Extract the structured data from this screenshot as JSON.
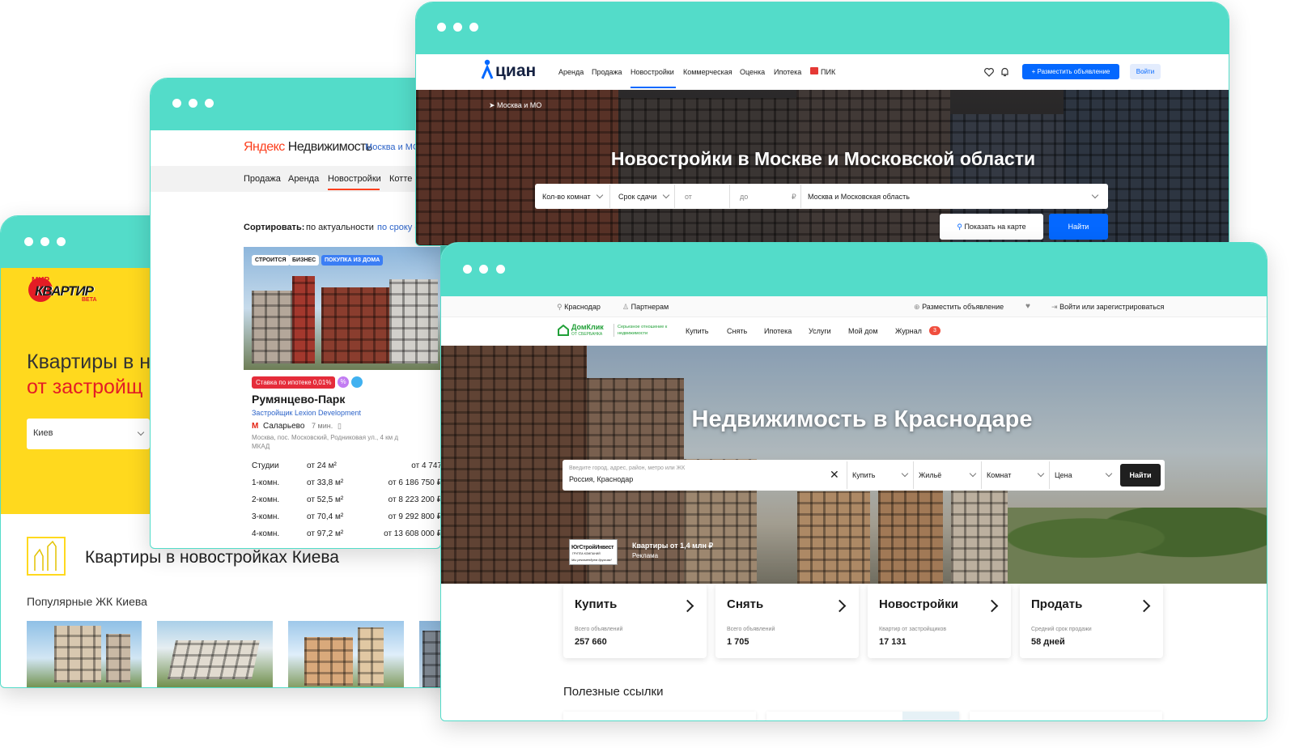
{
  "mirkvartir": {
    "logo_top": "МИР",
    "logo_main": "КВАРТИР",
    "logo_beta": "BETA",
    "hero_line1": "Квартиры в н",
    "hero_line2": "от застройщ",
    "city_select": "Киев",
    "section_title": "Квартиры в новостройках Киева",
    "popular_title": "Популярные ЖК Киева"
  },
  "yandex": {
    "logo_y": "Яндекс",
    "logo_rest": " Недвижимость",
    "region": "Москва и МО",
    "nav": [
      "Продажа",
      "Аренда",
      "Новостройки",
      "Котте"
    ],
    "sort_label": "Сортировать:",
    "sort_relevance": "по актуальности",
    "sort_deadline": "по сроку с",
    "badges": [
      "СТРОИТСЯ",
      "БИЗНЕС",
      "ПОКУПКА ИЗ ДОМА"
    ],
    "mortgage_badge": "Ставка по ипотеке 0,01%",
    "percent_icon_text": "%",
    "complex_name": "Румянцево-Парк",
    "developer": "Застройщик Lexion Development",
    "metro_icon": "М",
    "metro": "Саларьево",
    "metro_time": "7 мин.",
    "address": "Москва, пос. Московский, Родниковая ул., 4 км д МКАД",
    "rows": [
      {
        "type": "Студии",
        "area": "от 24 м²",
        "price": "от 4 747"
      },
      {
        "type": "1-комн.",
        "area": "от 33,8 м²",
        "price": "от 6 186 750 ₽"
      },
      {
        "type": "2-комн.",
        "area": "от 52,5 м²",
        "price": "от 8 223 200 ₽"
      },
      {
        "type": "3-комн.",
        "area": "от 70,4 м²",
        "price": "от 9 292 800 ₽"
      },
      {
        "type": "4-комн.",
        "area": "от 97,2 м²",
        "price": "от 13 608 000 ₽"
      }
    ]
  },
  "cian": {
    "logo": "циан",
    "nav": [
      "Аренда",
      "Продажа",
      "Новостройки",
      "Коммерческая",
      "Оценка",
      "Ипотека",
      "ПИК"
    ],
    "post_button": "+ Разместить объявление",
    "login_button": "Войти",
    "breadcrumb": "Москва и МО",
    "hero_title": "Новостройки в Москве и Московской области",
    "filters": {
      "rooms": "Кол-во комнат",
      "deadline": "Срок сдачи",
      "price_from": "от",
      "price_to": "до",
      "currency": "₽",
      "region": "Москва и Московская область"
    },
    "map_button": "Показать на карте",
    "find_button": "Найти"
  },
  "domclick": {
    "top_city": "Краснодар",
    "top_partners": "Партнерам",
    "top_post": "Разместить объявление",
    "top_login": "Войти или зарегистрироваться",
    "logo_main": "ДомКлик",
    "logo_sub": "ОТ СБЕРБАНКА",
    "logo_tagline": "Серьезное отношение к недвижимости",
    "nav": [
      "Купить",
      "Снять",
      "Ипотека",
      "Услуги",
      "Мой дом",
      "Журнал"
    ],
    "journal_badge": "3",
    "hero_title": "Недвижимость в Краснодаре",
    "search_hint": "Введите город, адрес, район, метро или ЖК",
    "search_value": "Россия, Краснодар",
    "selects": [
      "Купить",
      "Жильё",
      "Комнат",
      "Цена"
    ],
    "find_button": "Найти",
    "ad_logo": "ЮгСтройИнвест",
    "ad_logo_sub": "ГРУППА КОМПАНИЙ",
    "ad_logo_slogan": "Мы рекомендуем друзьям!",
    "ad_title": "Квартиры от 1,4 млн ₽",
    "ad_label": "Реклама",
    "cards": [
      {
        "title": "Купить",
        "caption": "Всего объявлений",
        "value": "257 660"
      },
      {
        "title": "Снять",
        "caption": "Всего объявлений",
        "value": "1 705"
      },
      {
        "title": "Новостройки",
        "caption": "Квартир от застройщиков",
        "value": "17 131"
      },
      {
        "title": "Продать",
        "caption": "Средний срок продажи",
        "value": "58 дней"
      }
    ],
    "useful_links": "Полезные ссылки"
  },
  "colors": {
    "window_bar": "#53dcc9",
    "cian_blue": "#0468ff",
    "yandex_red": "#fc3f1d",
    "mirkvartir_yellow": "#ffd91e",
    "domclick_green": "#21a038"
  }
}
